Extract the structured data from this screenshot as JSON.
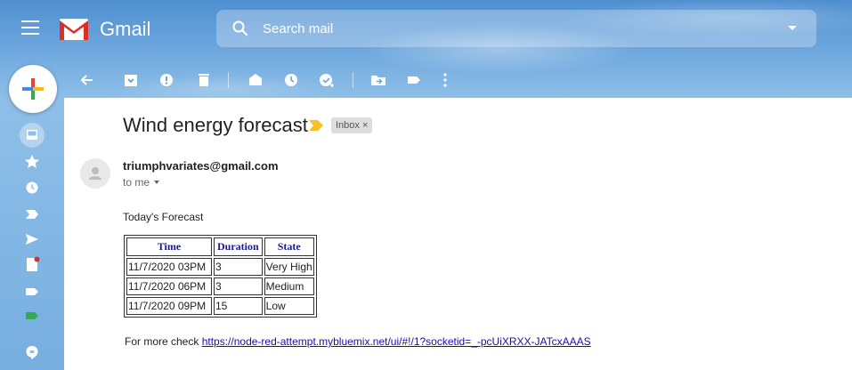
{
  "app": {
    "brand": "Gmail"
  },
  "search": {
    "placeholder": "Search mail"
  },
  "colors": {
    "accent_red": "#d93025",
    "sky_blue": "#5b97d6",
    "link": "#1a0dab",
    "table_header": "#1a1a8c"
  },
  "toolbar": {
    "icons": [
      "back-icon",
      "archive-icon",
      "report-spam-icon",
      "delete-icon",
      "mark-unread-icon",
      "snooze-icon",
      "add-to-tasks-icon",
      "move-to-icon",
      "labels-icon",
      "more-icon"
    ]
  },
  "rail": {
    "icons": [
      "inbox-icon",
      "starred-icon",
      "snoozed-icon",
      "important-icon",
      "sent-icon",
      "drafts-icon",
      "label-icon",
      "label-green-icon",
      "hangouts-icon"
    ]
  },
  "email": {
    "subject": "Wind energy forecast",
    "tag": "Inbox ×",
    "sender": "triumphvariates@gmail.com",
    "recipient": "to me",
    "intro": "Today's Forecast",
    "table": {
      "headers": [
        "Time",
        "Duration",
        "State"
      ],
      "rows": [
        [
          "11/7/2020 03PM",
          "3",
          "Very High"
        ],
        [
          "11/7/2020 06PM",
          "3",
          "Medium"
        ],
        [
          "11/7/2020 09PM",
          "15",
          "Low"
        ]
      ]
    },
    "footer_prefix": "For more check ",
    "footer_link": "https://node-red-attempt.mybluemix.net/ui/#!/1?socketid=_-pcUiXRXX-JATcxAAAS"
  }
}
